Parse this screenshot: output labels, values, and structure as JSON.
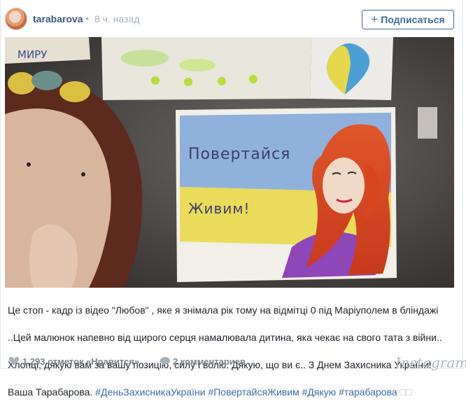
{
  "header": {
    "username": "tarabarova",
    "separator": "•",
    "time_ago": "8 ч. назад",
    "follow_label": "Подписаться",
    "follow_icon": "plus-icon"
  },
  "photo": {
    "drawing_text_top": "Повертайся",
    "drawing_text_bottom": "Живим!",
    "corner_text": "МИРУ"
  },
  "caption": {
    "lines": [
      "Це стоп - кадр із відео \"Любов\" , яке я знімала рік тому на відмітці 0 під Маріуполем в бліндажі",
      "..Цей малюнок напевно від щирого серця намалювала дитина, яка чекає на свого тата з війни..",
      "Хлопці, дякую вам за вашу позицію, силу і волю. Дякую, що ви є.. З Днем Захисника України!"
    ],
    "signature": "Ваша Тарабарова.",
    "hashtags": [
      "#ДеньЗахисникаУкраїни",
      "#ПовертайсяЖивим",
      "#Дякую",
      "#тарабарова"
    ],
    "trailing": "□□"
  },
  "footer": {
    "likes": "1,293 отметок «Нравится»",
    "comments": "2 комментариев",
    "brand": "Instagram"
  },
  "colors": {
    "link": "#3d6da0",
    "username": "#3d5a80",
    "muted": "#a9b2bb"
  }
}
